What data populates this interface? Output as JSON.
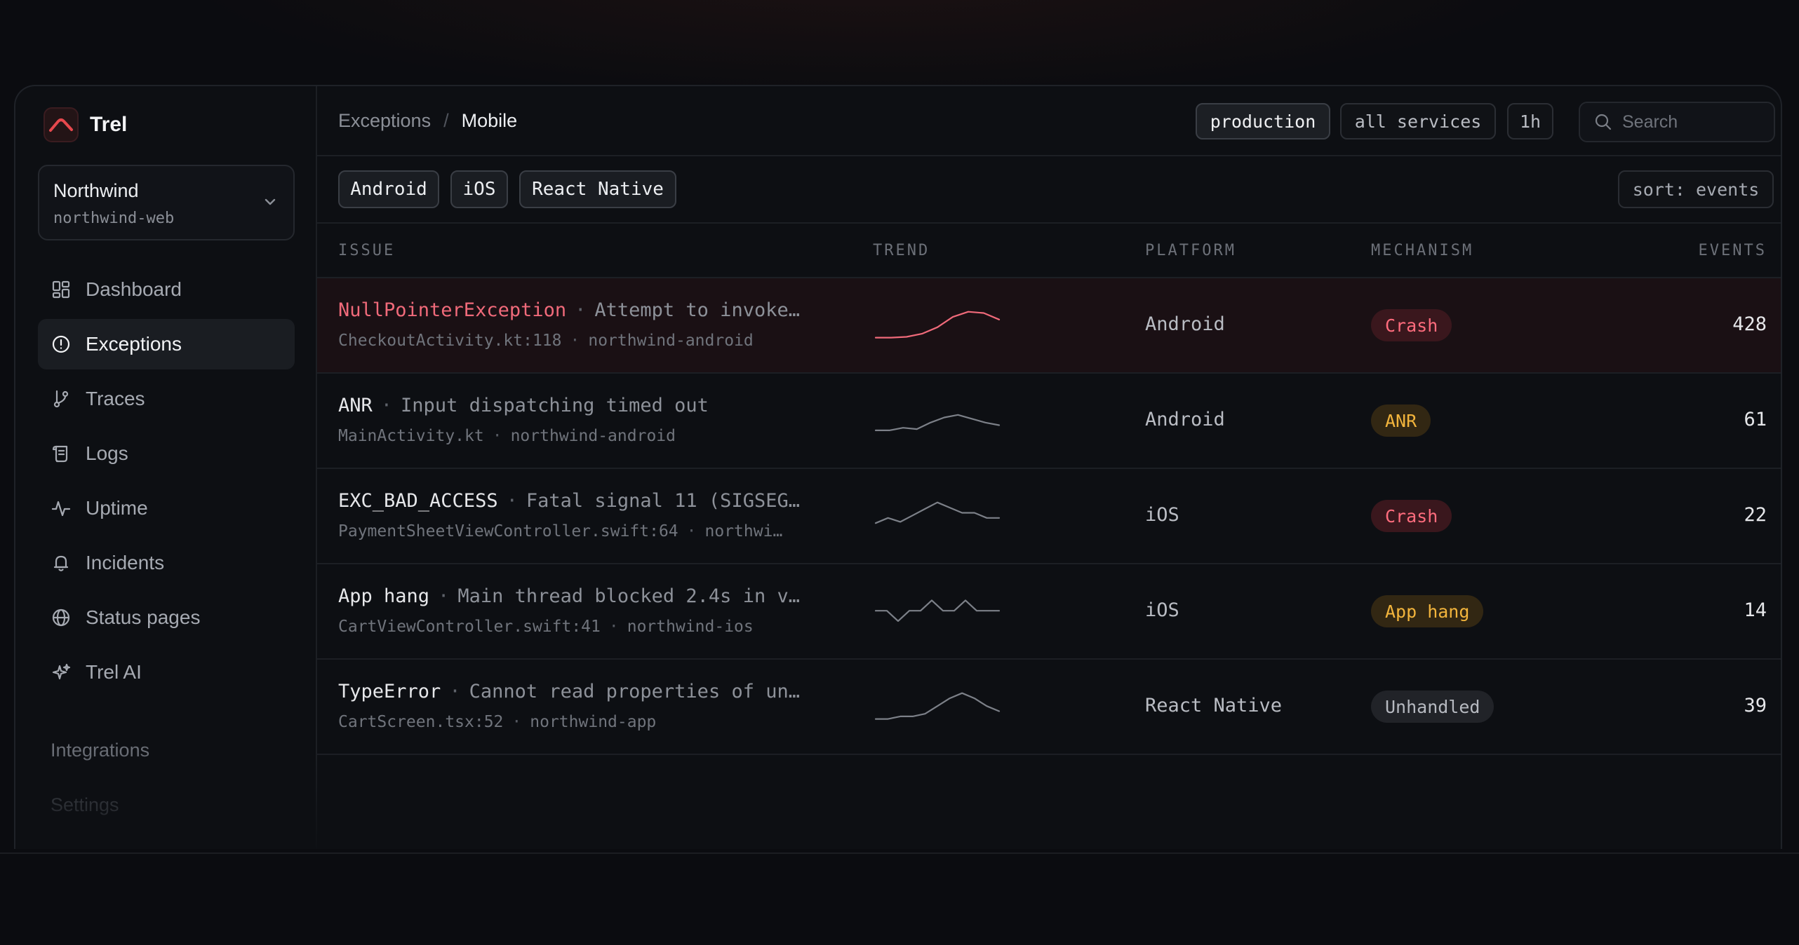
{
  "brand": {
    "name": "Trel",
    "accent": "#e5484d"
  },
  "project": {
    "name": "Northwind",
    "slug": "northwind-web"
  },
  "nav": {
    "items": [
      {
        "label": "Dashboard",
        "icon": "dashboard-icon"
      },
      {
        "label": "Exceptions",
        "icon": "alert-circle-icon",
        "active": true
      },
      {
        "label": "Traces",
        "icon": "branch-icon"
      },
      {
        "label": "Logs",
        "icon": "scroll-icon"
      },
      {
        "label": "Uptime",
        "icon": "pulse-icon"
      },
      {
        "label": "Incidents",
        "icon": "bell-icon"
      },
      {
        "label": "Status pages",
        "icon": "globe-icon"
      },
      {
        "label": "Trel AI",
        "icon": "sparkle-icon"
      }
    ],
    "secondary": [
      "Integrations",
      "Settings"
    ]
  },
  "breadcrumb": {
    "section": "Exceptions",
    "separator": "/",
    "page": "Mobile"
  },
  "topbar": {
    "environment": "production",
    "services": "all services",
    "range": "1h",
    "search_placeholder": "Search"
  },
  "filters": {
    "platforms": [
      "Android",
      "iOS",
      "React Native"
    ],
    "sort": "sort: events"
  },
  "table": {
    "headers": {
      "issue": "ISSUE",
      "trend": "TREND",
      "platform": "PLATFORM",
      "mechanism": "MECHANISM",
      "events": "EVENTS"
    },
    "rows": [
      {
        "name": "NullPointerException",
        "message": "Attempt to invoke…",
        "location": "CheckoutActivity.kt:118",
        "service": "northwind-android",
        "platform": "Android",
        "mechanism": "Crash",
        "mechanism_kind": "crash",
        "events": "428",
        "trend": [
          2,
          2,
          2.3,
          3.5,
          6,
          10,
          12,
          11.5,
          9
        ],
        "highlight": true
      },
      {
        "name": "ANR",
        "message": "Input dispatching timed out",
        "location": "MainActivity.kt",
        "service": "northwind-android",
        "platform": "Android",
        "mechanism": "ANR",
        "mechanism_kind": "warn",
        "events": "61",
        "trend": [
          3,
          3,
          4,
          3.5,
          6,
          8,
          9,
          7.5,
          6,
          5
        ],
        "highlight": false
      },
      {
        "name": "EXC_BAD_ACCESS",
        "message": "Fatal signal 11 (SIGSEG…",
        "location": "PaymentSheetViewController.swift:64",
        "service": "northwi…",
        "platform": "iOS",
        "mechanism": "Crash",
        "mechanism_kind": "crash",
        "events": "22",
        "trend": [
          4,
          6,
          4.5,
          7,
          9.5,
          12,
          10,
          8,
          8,
          6,
          6
        ],
        "highlight": false
      },
      {
        "name": "App hang",
        "message": "Main thread blocked 2.4s in v…",
        "location": "CartViewController.swift:41",
        "service": "northwind-ios",
        "platform": "iOS",
        "mechanism": "App hang",
        "mechanism_kind": "warn",
        "events": "14",
        "trend": [
          7,
          7,
          3,
          7,
          7,
          11,
          7,
          7,
          11,
          7,
          7,
          7
        ],
        "highlight": false
      },
      {
        "name": "TypeError",
        "message": "Cannot read properties of un…",
        "location": "CartScreen.tsx:52",
        "service": "northwind-app",
        "platform": "React Native",
        "mechanism": "Unhandled",
        "mechanism_kind": "neutral",
        "events": "39",
        "trend": [
          2,
          2,
          3,
          3,
          4,
          7,
          10,
          12,
          10,
          7,
          5
        ],
        "highlight": false
      }
    ]
  }
}
